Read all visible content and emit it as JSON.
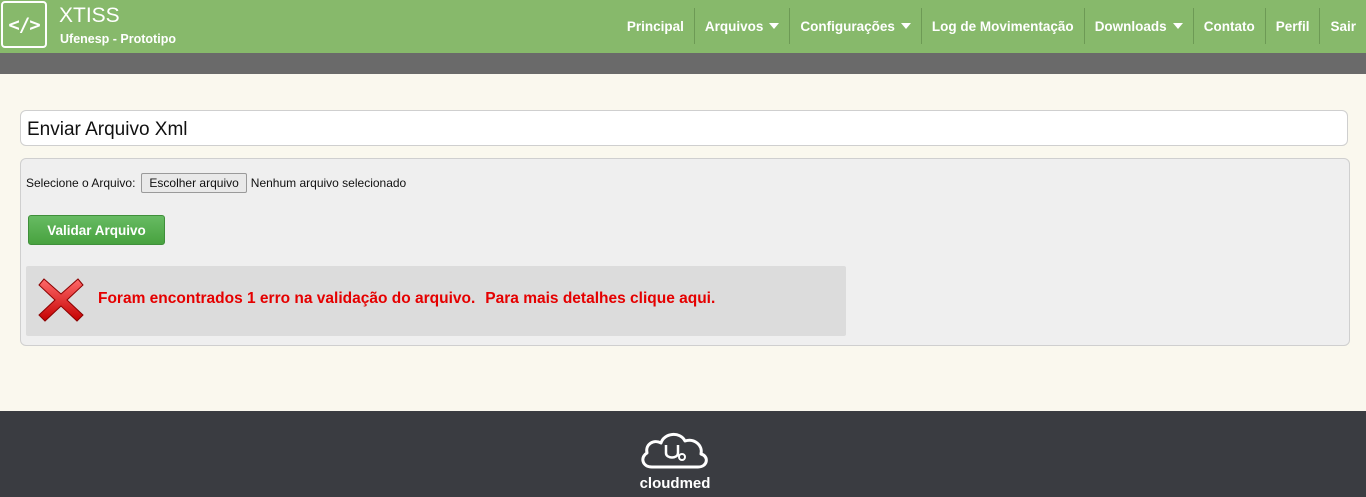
{
  "app": {
    "logo_glyph": "</>",
    "title": "XTISS",
    "subtitle": "Ufenesp - Prototipo"
  },
  "nav": {
    "items": [
      {
        "label": "Principal",
        "dropdown": false
      },
      {
        "label": "Arquivos",
        "dropdown": true
      },
      {
        "label": "Configurações",
        "dropdown": true
      },
      {
        "label": "Log de Movimentação",
        "dropdown": false
      },
      {
        "label": "Downloads",
        "dropdown": true
      },
      {
        "label": "Contato",
        "dropdown": false
      },
      {
        "label": "Perfil",
        "dropdown": false
      },
      {
        "label": "Sair",
        "dropdown": false
      }
    ]
  },
  "page": {
    "title": "Enviar Arquivo Xml"
  },
  "form": {
    "file_label": "Selecione o Arquivo:",
    "file_button": "Escolher arquivo",
    "file_status": "Nenhum arquivo selecionado",
    "validate_button": "Validar Arquivo"
  },
  "error": {
    "icon": "red-x-icon",
    "message": "Foram encontrados 1 erro na validação do arquivo.",
    "link": "Para mais detalhes clique aqui."
  },
  "footer": {
    "brand": "cloudmed",
    "icon": "cloud-stethoscope-icon"
  },
  "colors": {
    "header": "#87b96b",
    "subbar": "#6a6a6a",
    "page_bg": "#faf8ee",
    "error_text": "#e50000",
    "button_green": "#4ea846",
    "footer": "#3a3c41"
  }
}
